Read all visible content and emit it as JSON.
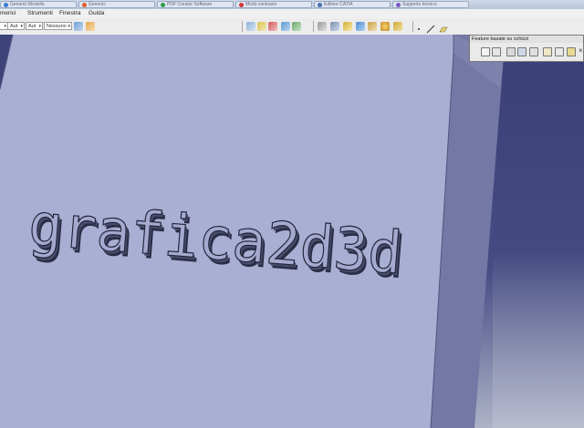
{
  "taskbar": {
    "tabs": [
      {
        "label": "Generici Modello",
        "color": "#3a7bd5"
      },
      {
        "label": "Generici",
        "color": "#e05a2a"
      },
      {
        "label": "PDF Creator Software",
        "color": "#2d9d4a"
      },
      {
        "label": "Modo contrasto",
        "color": "#d13438"
      },
      {
        "label": "Editore CATIA",
        "color": "#4a6fb5"
      },
      {
        "label": "Supporto tecnico",
        "color": "#7a5bc4"
      }
    ]
  },
  "menu": {
    "items": [
      {
        "label": "merici"
      },
      {
        "label": "Strumenti"
      },
      {
        "label": "Finestra"
      },
      {
        "label": "Guida"
      }
    ]
  },
  "toolbar": {
    "combo_a": "Aut",
    "combo_b": "Aut",
    "combo_c": "Nessuno"
  },
  "panel": {
    "title": "Feature basate su schizzi",
    "close": "×"
  },
  "model": {
    "text": "grafica2d3d"
  },
  "colors": {
    "face": "#a9aed3",
    "side_face": "#7378a4",
    "background": "#3e4379",
    "text_front": "#a5a9cf"
  }
}
